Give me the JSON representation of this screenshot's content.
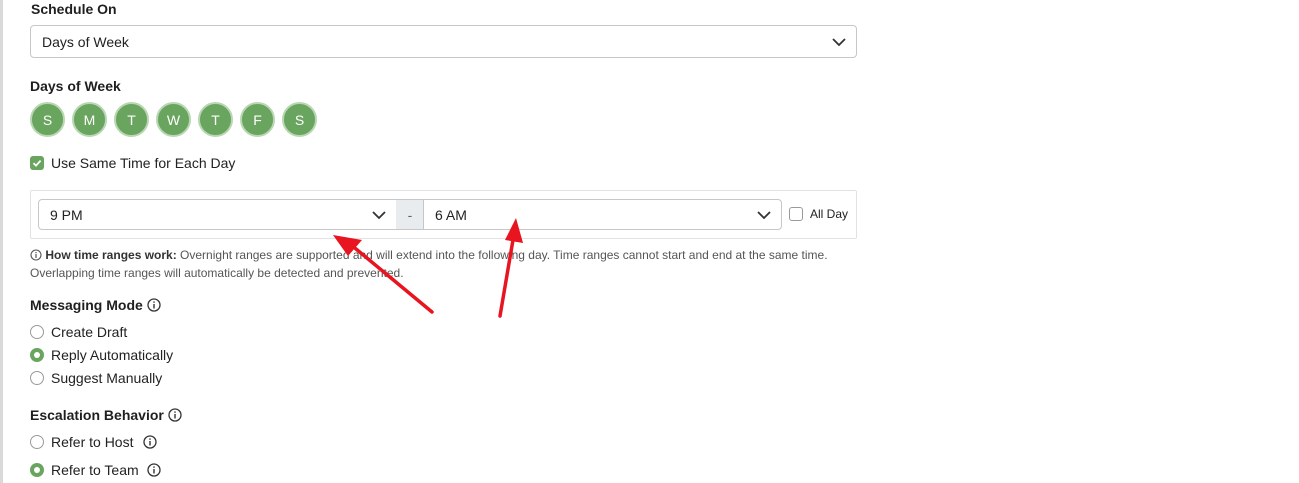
{
  "schedule": {
    "label": "Schedule On",
    "selected": "Days of Week"
  },
  "days_of_week": {
    "label": "Days of Week",
    "days": [
      "S",
      "M",
      "T",
      "W",
      "T",
      "F",
      "S"
    ]
  },
  "same_time": {
    "label": "Use Same Time for Each Day",
    "checked": true
  },
  "time_range": {
    "start": "9 PM",
    "separator": "-",
    "end": "6 AM",
    "all_day_label": "All Day",
    "all_day_checked": false
  },
  "note": {
    "title": "How time ranges work:",
    "line1": " Overnight ranges are supported and will extend into the following day. Time ranges cannot start and end at the same time.",
    "line2": "Overlapping time ranges will automatically be detected and prevented."
  },
  "messaging_mode": {
    "label": "Messaging Mode",
    "options": [
      "Create Draft",
      "Reply Automatically",
      "Suggest Manually"
    ],
    "selected_index": 1
  },
  "escalation": {
    "label": "Escalation Behavior",
    "options": [
      "Refer to Host",
      "Refer to Team"
    ],
    "selected_index": 1
  },
  "colors": {
    "accent": "#6aa560",
    "annotation_arrow": "#e8141f"
  }
}
